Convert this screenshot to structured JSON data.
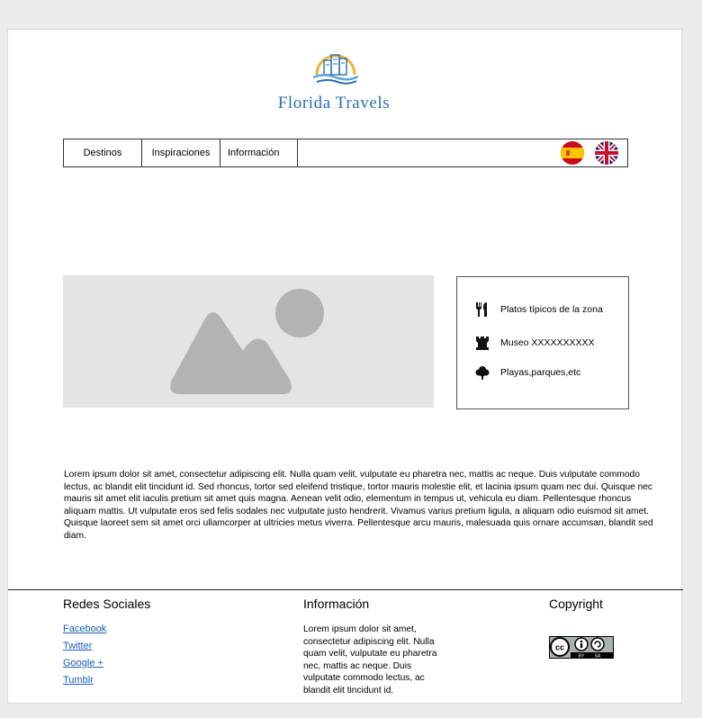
{
  "brand": {
    "name": "Florida Travels"
  },
  "nav": {
    "items": [
      {
        "label": "Destinos"
      },
      {
        "label": "Inspiraciones"
      },
      {
        "label": "Información"
      }
    ],
    "languages": [
      {
        "name": "spain-flag-icon"
      },
      {
        "name": "uk-flag-icon"
      }
    ]
  },
  "hero": {
    "icon": "image-placeholder-icon"
  },
  "infobox": {
    "items": [
      {
        "icon": "fork-knife-icon",
        "label": "Platos típicos de la zona"
      },
      {
        "icon": "castle-tower-icon",
        "label": "Museo XXXXXXXXXX"
      },
      {
        "icon": "tree-icon",
        "label": "Playas,parques,etc"
      }
    ]
  },
  "body_text": "Lorem ipsum dolor sit amet, consectetur adipiscing elit. Nulla quam velit, vulputate eu pharetra nec, mattis ac neque. Duis vulputate commodo lectus, ac blandit elit tincidunt id. Sed rhoncus, tortor sed eleifend tristique, tortor mauris molestie elit, et lacinia ipsum quam nec dui. Quisque nec mauris sit amet elit iaculis pretium sit amet quis magna. Aenean velit odio, elementum in tempus ut, vehicula eu diam. Pellentesque rhoncus aliquam mattis. Ut vulputate eros sed felis sodales nec vulputate justo hendrerit. Vivamus varius pretium ligula, a aliquam odio euismod sit amet. Quisque laoreet sem sit amet orci ullamcorper at ultricies metus viverra. Pellentesque arcu mauris, malesuada quis ornare accumsan, blandit sed diam.",
  "footer": {
    "social": {
      "title": "Redes Sociales",
      "links": [
        {
          "label": "Facebook"
        },
        {
          "label": "Twitter"
        },
        {
          "label": "Google  +"
        },
        {
          "label": "Tumblr "
        }
      ]
    },
    "info": {
      "title": "Información",
      "text": "Lorem ipsum dolor sit amet, consectetur adipiscing elit. Nulla quam velit, vulputate eu pharetra nec, mattis ac neque. Duis vulputate commodo lectus, ac blandit elit tincidunt id."
    },
    "copyright": {
      "title": "Copyright",
      "badge": {
        "cc": "cc",
        "by": "BY",
        "sa": "SA"
      }
    }
  },
  "colors": {
    "brand_blue": "#2a6fb0",
    "link_blue": "#1a5fb4",
    "placeholder_gray": "#b3b3b3"
  }
}
